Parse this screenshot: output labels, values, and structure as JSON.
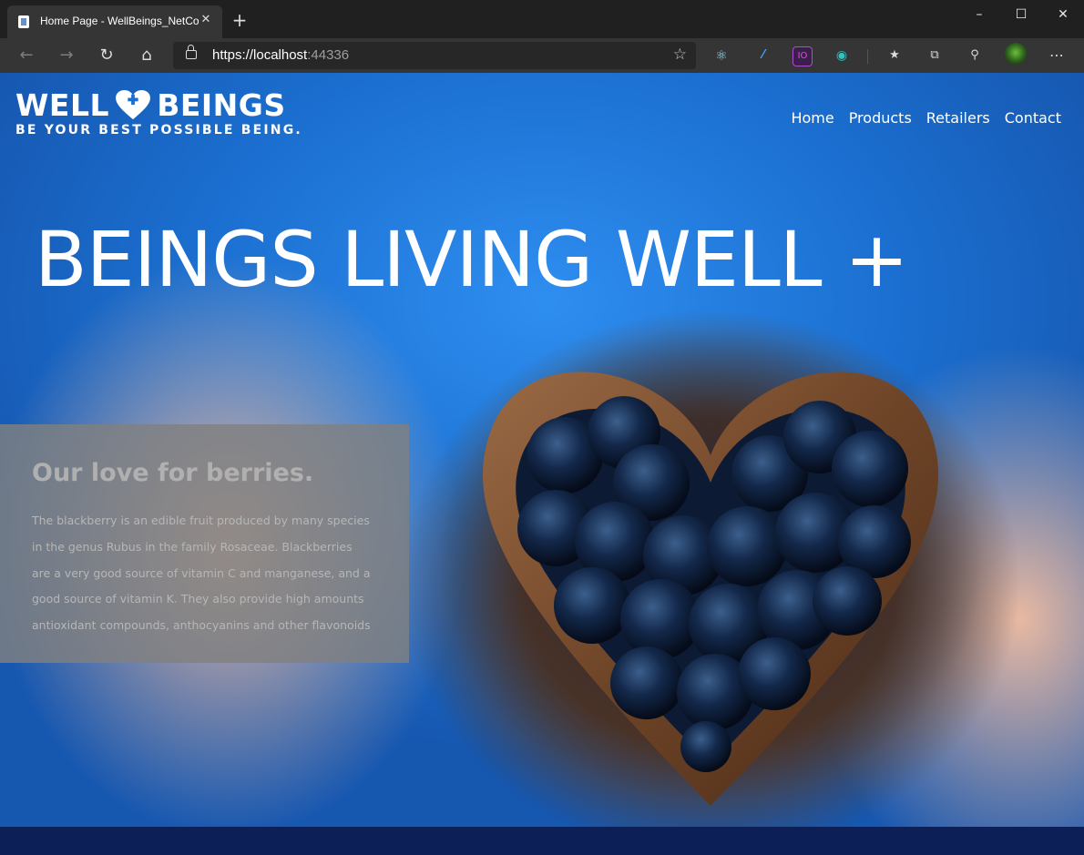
{
  "browser": {
    "tab_title": "Home Page - WellBeings_NetCor",
    "tab_close": "✕",
    "new_tab": "+",
    "url_host": "https://localhost",
    "url_port": ":44336",
    "window_controls": {
      "minimize": "–",
      "maximize": "☐",
      "close": "✕"
    },
    "nav_icons": [
      "back-arrow-icon",
      "forward-arrow-icon",
      "refresh-icon",
      "home-icon"
    ],
    "toolbar_icons": [
      "react-devtools-icon",
      "extension-feather-icon",
      "extension-io-icon",
      "extension-circle-icon",
      "favorites-icon",
      "collections-icon",
      "feedback-icon",
      "profile-avatar",
      "more-icon"
    ]
  },
  "site": {
    "logo_left": "WELL",
    "logo_right": "BEINGS",
    "tagline": "BE YOUR BEST POSSIBLE  BEING.",
    "nav": [
      "Home",
      "Products",
      "Retailers",
      "Contact"
    ]
  },
  "hero": {
    "title": "BEINGS LIVING WELL +"
  },
  "info": {
    "title": "Our love for berries.",
    "body": "The blackberry is an edible fruit produced by many species in the genus Rubus in the family Rosaceae. Blackberries are a very good source of vitamin C and manganese, and a good source of vitamin K. They also provide high amounts antioxidant compounds, anthocyanins and other flavonoids"
  },
  "colors": {
    "hero_blue": "#1b6fd0",
    "footer_navy": "#0c1f57",
    "info_box_gray": "#808080"
  }
}
